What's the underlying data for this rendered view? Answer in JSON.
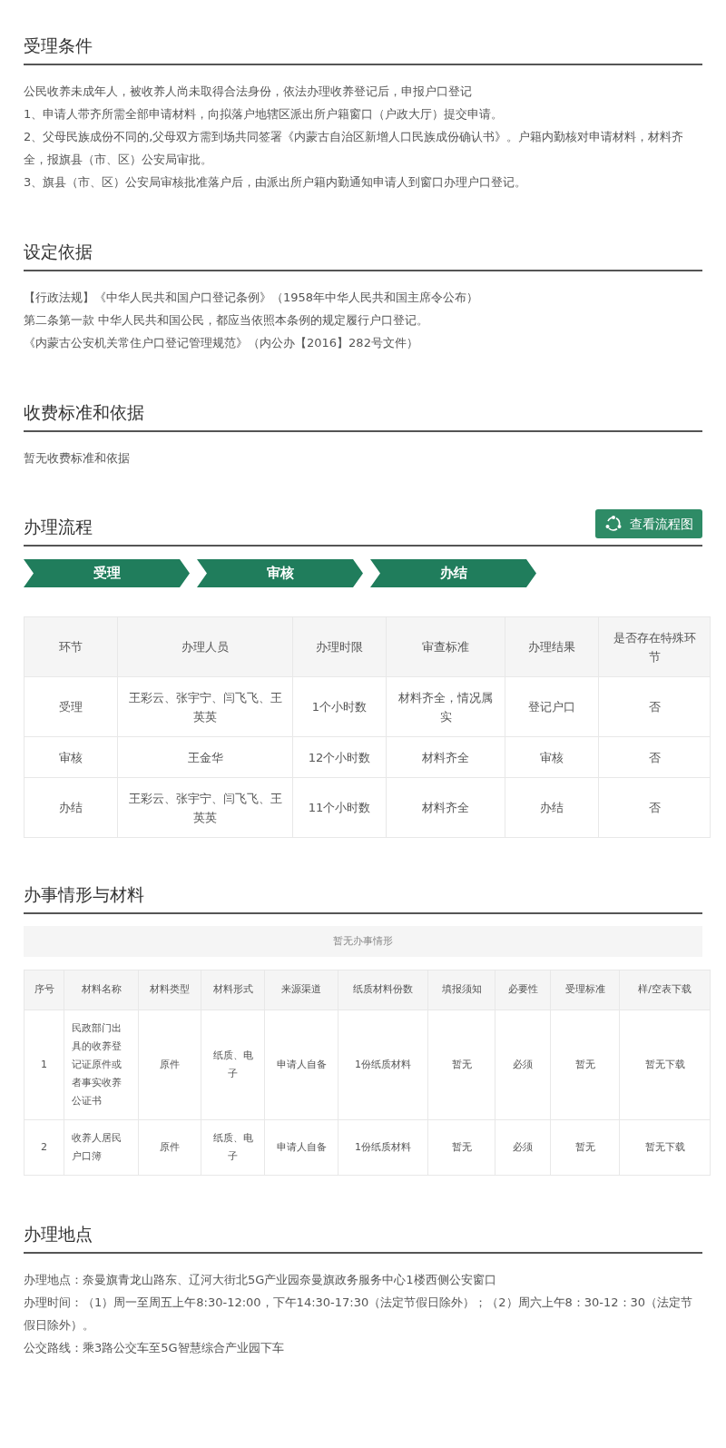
{
  "acceptance": {
    "title": "受理条件",
    "lines": [
      "公民收养未成年人，被收养人尚未取得合法身份，依法办理收养登记后，申报户口登记",
      "1、申请人带齐所需全部申请材料，向拟落户地辖区派出所户籍窗口（户政大厅）提交申请。",
      "2、父母民族成份不同的,父母双方需到场共同签署《内蒙古自治区新增人口民族成份确认书》。户籍内勤核对申请材料，材料齐全，报旗县（市、区）公安局审批。",
      "3、旗县（市、区）公安局审核批准落户后，由派出所户籍内勤通知申请人到窗口办理户口登记。"
    ]
  },
  "basis": {
    "title": "设定依据",
    "lines": [
      "【行政法规】《中华人民共和国户口登记条例》（1958年中华人民共和国主席令公布）",
      "第二条第一款 中华人民共和国公民，都应当依照本条例的规定履行户口登记。",
      "《内蒙古公安机关常住户口登记管理规范》（内公办【2016】282号文件）"
    ]
  },
  "fees": {
    "title": "收费标准和依据",
    "lines": [
      "暂无收费标准和依据"
    ]
  },
  "process": {
    "title": "办理流程",
    "button": "查看流程图",
    "steps": [
      "受理",
      "审核",
      "办结"
    ],
    "columns": [
      "环节",
      "办理人员",
      "办理时限",
      "审查标准",
      "办理结果",
      "是否存在特殊环节"
    ],
    "rows": [
      [
        "受理",
        "王彩云、张宇宁、闫飞飞、王英英",
        "1个小时数",
        "材料齐全，情况属实",
        "登记户口",
        "否"
      ],
      [
        "审核",
        "王金华",
        "12个小时数",
        "材料齐全",
        "审核",
        "否"
      ],
      [
        "办结",
        "王彩云、张宇宁、闫飞飞、王英英",
        "11个小时数",
        "材料齐全",
        "办结",
        "否"
      ]
    ]
  },
  "materials": {
    "title": "办事情形与材料",
    "empty_note": "暂无办事情形",
    "columns": [
      "序号",
      "材料名称",
      "材料类型",
      "材料形式",
      "来源渠道",
      "纸质材料份数",
      "填报须知",
      "必要性",
      "受理标准",
      "样/空表下载"
    ],
    "rows": [
      [
        "1",
        "民政部门出具的收养登记证原件或者事实收养公证书",
        "原件",
        "纸质、电子",
        "申请人自备",
        "1份纸质材料",
        "暂无",
        "必须",
        "暂无",
        "暂无下载"
      ],
      [
        "2",
        "收养人居民户口簿",
        "原件",
        "纸质、电子",
        "申请人自备",
        "1份纸质材料",
        "暂无",
        "必须",
        "暂无",
        "暂无下载"
      ]
    ]
  },
  "location": {
    "title": "办理地点",
    "lines": [
      "办理地点：奈曼旗青龙山路东、辽河大街北5G产业园奈曼旗政务服务中心1楼西侧公安窗口",
      "办理时间：（1）周一至周五上午8:30-12:00，下午14:30-17:30（法定节假日除外）；（2）周六上午8：30-12：30（法定节假日除外）。",
      "公交路线：乘3路公交车至5G智慧综合产业园下车"
    ]
  }
}
